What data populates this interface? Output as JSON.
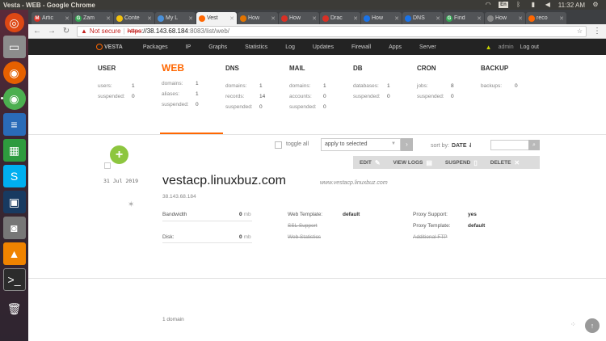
{
  "window": {
    "title": "Vesta - WEB - Google Chrome",
    "time": "11:32 AM",
    "lang": "En"
  },
  "tabs": [
    {
      "label": "Artic",
      "fav_color": "#d93025",
      "fav": "M"
    },
    {
      "label": "Zam",
      "fav_color": "#34a853",
      "fav": "G"
    },
    {
      "label": "Conte",
      "fav_color": "#f4c20d",
      "fav": ""
    },
    {
      "label": "My L",
      "fav_color": "#4a90d9",
      "fav": ""
    },
    {
      "label": "Vest",
      "fav_color": "#ff6701",
      "fav": "",
      "active": true
    },
    {
      "label": "How",
      "fav_color": "#e37400",
      "fav": ""
    },
    {
      "label": "How",
      "fav_color": "#d93025",
      "fav": ""
    },
    {
      "label": "Drac",
      "fav_color": "#d93025",
      "fav": ""
    },
    {
      "label": "How",
      "fav_color": "#1a73e8",
      "fav": ""
    },
    {
      "label": "DNS",
      "fav_color": "#1a73e8",
      "fav": ""
    },
    {
      "label": "Find",
      "fav_color": "#34a853",
      "fav": "G"
    },
    {
      "label": "How",
      "fav_color": "#888",
      "fav": ""
    },
    {
      "label": "reco",
      "fav_color": "#ff6701",
      "fav": ""
    }
  ],
  "address": {
    "warning": "Not secure",
    "scheme": "https",
    "host": "://38.143.68.184",
    "path": ":8083/list/web/"
  },
  "nav": {
    "logo": "VESTA",
    "items": [
      "Packages",
      "IP",
      "Graphs",
      "Statistics",
      "Log",
      "Updates",
      "Firewall",
      "Apps",
      "Server"
    ],
    "user": "admin",
    "logout": "Log out"
  },
  "stats": {
    "user": {
      "title": "USER",
      "rows": [
        [
          "users:",
          "1"
        ],
        [
          "suspended:",
          "0"
        ]
      ]
    },
    "web": {
      "title": "WEB",
      "rows": [
        [
          "domains:",
          "1"
        ],
        [
          "aliases:",
          "1"
        ],
        [
          "suspended:",
          "0"
        ]
      ]
    },
    "dns": {
      "title": "DNS",
      "rows": [
        [
          "domains:",
          "1"
        ],
        [
          "records:",
          "14"
        ],
        [
          "suspended:",
          "0"
        ]
      ]
    },
    "mail": {
      "title": "MAIL",
      "rows": [
        [
          "domains:",
          "1"
        ],
        [
          "accounts:",
          "0"
        ],
        [
          "suspended:",
          "0"
        ]
      ]
    },
    "db": {
      "title": "DB",
      "rows": [
        [
          "databases:",
          "1"
        ],
        [
          "suspended:",
          "0"
        ]
      ]
    },
    "cron": {
      "title": "CRON",
      "rows": [
        [
          "jobs:",
          "8"
        ],
        [
          "suspended:",
          "0"
        ]
      ]
    },
    "backup": {
      "title": "BACKUP",
      "rows": [
        [
          "backups:",
          "0"
        ]
      ]
    }
  },
  "toolbar": {
    "toggle_all": "toggle all",
    "apply_select": "apply to selected",
    "sort_by": "sort by:",
    "sort_value": "DATE ⇃"
  },
  "actions": {
    "edit": "EDIT",
    "view_logs": "VIEW LOGS",
    "suspend": "SUSPEND",
    "delete": "DELETE"
  },
  "domain_row": {
    "date": "31 Jul 2019",
    "domain": "vestacp.linuxbuz.com",
    "alias": "www.vestacp.linuxbuz.com",
    "ip": "38.143.68.184",
    "bandwidth_label": "Bandwidth",
    "bandwidth_value": "0",
    "bandwidth_unit": "mb",
    "disk_label": "Disk:",
    "disk_value": "0",
    "disk_unit": "mb",
    "web_template_label": "Web Template:",
    "web_template_value": "default",
    "ssl_support": "SSL Support",
    "web_statistics": "Web Statistics",
    "proxy_support_label": "Proxy Support:",
    "proxy_support_value": "yes",
    "proxy_template_label": "Proxy Template:",
    "proxy_template_value": "default",
    "additional_ftp": "Additional FTP"
  },
  "footer": {
    "count": "1 domain"
  }
}
